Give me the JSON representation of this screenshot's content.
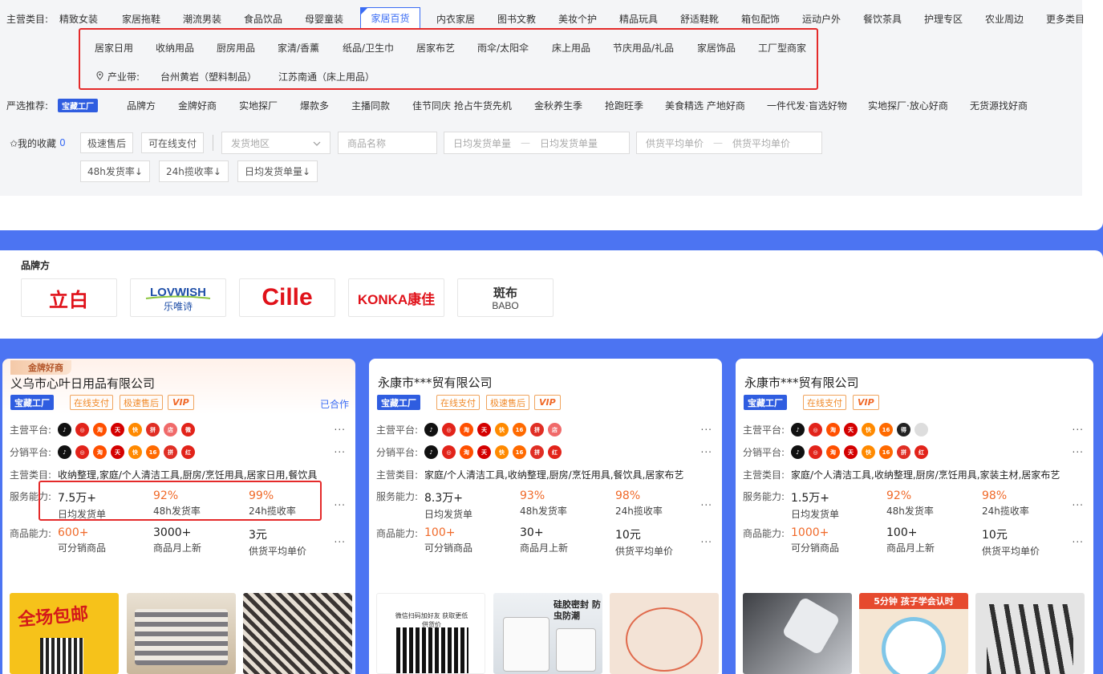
{
  "filter": {
    "main_label": "主营类目:",
    "categories": [
      "精致女装",
      "家居拖鞋",
      "潮流男装",
      "食品饮品",
      "母婴童装",
      "家居百货",
      "内衣家居",
      "图书文教",
      "美妆个护",
      "精品玩具",
      "舒适鞋靴",
      "箱包配饰",
      "运动户外",
      "餐饮茶具",
      "护理专区",
      "农业周边",
      "更多类目"
    ],
    "active_category": "家居百货",
    "sub_categories": [
      "居家日用",
      "收纳用品",
      "厨房用品",
      "家清/香薰",
      "纸品/卫生巾",
      "居家布艺",
      "雨伞/太阳伞",
      "床上用品",
      "节庆用品/礼品",
      "家居饰品",
      "工厂型商家"
    ],
    "industry_label": "产业带:",
    "industry_items": [
      "台州黄岩（塑料制品）",
      "江苏南通（床上用品）"
    ],
    "recommend_label": "严选推荐:",
    "recommend_badge": "宝藏工厂",
    "recommend_items": [
      "品牌方",
      "金牌好商",
      "实地探厂",
      "爆款多",
      "主播同款",
      "佳节同庆 抢占牛货先机",
      "金秋养生季",
      "抢跑旺季",
      "美食精选 产地好商",
      "一件代发·盲选好物",
      "实地探厂·放心好商",
      "无货源找好商"
    ],
    "fav_label": "✩我的收藏",
    "fav_count": "0",
    "quick_tags": [
      "极速售后",
      "可在线支付"
    ],
    "ship_area_placeholder": "发货地区",
    "product_name_placeholder": "商品名称",
    "daily_ship_from": "日均发货单量",
    "daily_ship_to": "日均发货单量",
    "price_from": "供货平均单价",
    "price_to": "供货平均单价",
    "sort_buttons": [
      "48h发货率↓",
      "24h揽收率↓",
      "日均发货单量↓"
    ]
  },
  "brands": {
    "title": "品牌方",
    "logos": [
      "立白",
      "LOVWISH 乐唯诗",
      "Cille",
      "KONKA康佳",
      "斑布 BABO"
    ]
  },
  "cards": [
    {
      "ribbon": "金牌好商",
      "name": "义乌市心叶日用品有限公司",
      "badges": [
        "宝藏工厂",
        "在线支付",
        "极速售后",
        "VIP"
      ],
      "cooperated": "已合作",
      "main_platform_label": "主营平台:",
      "dist_platform_label": "分销平台:",
      "category_label": "主营类目:",
      "categories": "收纳整理,家庭/个人清洁工具,厨房/烹饪用具,居家日用,餐饮具",
      "service_label": "服务能力:",
      "service": [
        {
          "v": "7.5万+",
          "l": "日均发货单"
        },
        {
          "v": "92%",
          "l": "48h发货率"
        },
        {
          "v": "99%",
          "l": "24h揽收率"
        }
      ],
      "product_label": "商品能力:",
      "product": [
        {
          "v": "600+",
          "l": "可分销商品"
        },
        {
          "v": "3000+",
          "l": "商品月上新"
        },
        {
          "v": "3元",
          "l": "供货平均单价"
        }
      ],
      "thumb_text": "全场包邮"
    },
    {
      "name": "永康市***贸有限公司",
      "badges": [
        "宝藏工厂",
        "在线支付",
        "极速售后",
        "VIP"
      ],
      "main_platform_label": "主营平台:",
      "dist_platform_label": "分销平台:",
      "category_label": "主营类目:",
      "categories": "家庭/个人清洁工具,收纳整理,厨房/烹饪用具,餐饮具,居家布艺",
      "service_label": "服务能力:",
      "service": [
        {
          "v": "8.3万+",
          "l": "日均发货单"
        },
        {
          "v": "93%",
          "l": "48h发货率"
        },
        {
          "v": "98%",
          "l": "24h揽收率"
        }
      ],
      "product_label": "商品能力:",
      "product": [
        {
          "v": "100+",
          "l": "可分销商品"
        },
        {
          "v": "30+",
          "l": "商品月上新"
        },
        {
          "v": "10元",
          "l": "供货平均单价"
        }
      ],
      "thumb_text": "硅胶密封 防虫防潮"
    },
    {
      "name": "永康市***贸有限公司",
      "badges": [
        "宝藏工厂",
        "在线支付",
        "VIP"
      ],
      "main_platform_label": "主营平台:",
      "dist_platform_label": "分销平台:",
      "category_label": "主营类目:",
      "categories": "家庭/个人清洁工具,收纳整理,厨房/烹饪用具,家装主材,居家布艺",
      "service_label": "服务能力:",
      "service": [
        {
          "v": "1.5万+",
          "l": "日均发货单"
        },
        {
          "v": "92%",
          "l": "48h发货率"
        },
        {
          "v": "98%",
          "l": "24h揽收率"
        }
      ],
      "product_label": "商品能力:",
      "product": [
        {
          "v": "1000+",
          "l": "可分销商品"
        },
        {
          "v": "100+",
          "l": "商品月上新"
        },
        {
          "v": "10元",
          "l": "供货平均单价"
        }
      ],
      "thumb_text": "5分钟 孩子学会认时"
    }
  ],
  "qr_text": "微信扫码加好友 获取更低供货价",
  "more_icon": "..."
}
